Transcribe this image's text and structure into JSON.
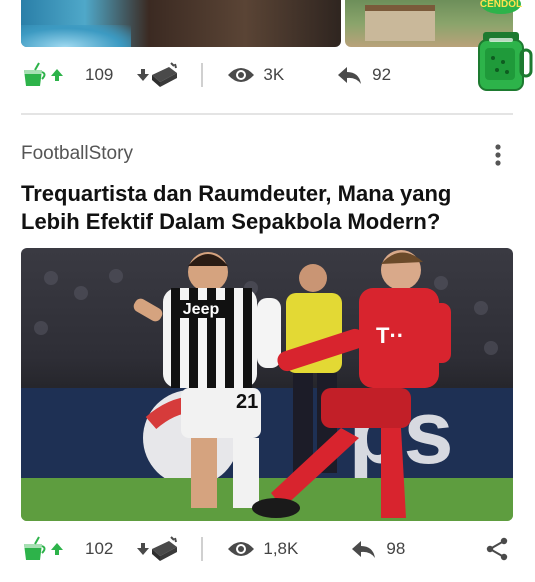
{
  "prev_post": {
    "votes_up": "109",
    "views": "3K",
    "shares": "92"
  },
  "mascot": {
    "label": "CENDOL"
  },
  "post": {
    "source": "FootballStory",
    "title": "Trequartista dan Raumdeuter, Mana yang Lebih Efektif Dalam Sepakbola Modern?",
    "votes_up": "102",
    "views": "1,8K",
    "shares": "98",
    "image_text": {
      "player1_sponsor": "Jeep",
      "player1_number": "21",
      "player2_sponsor": "T··",
      "board_text": "ps"
    }
  },
  "colors": {
    "accent_green": "#2db34a",
    "icon_gray": "#4a4a4a",
    "count_gray": "#444444"
  }
}
